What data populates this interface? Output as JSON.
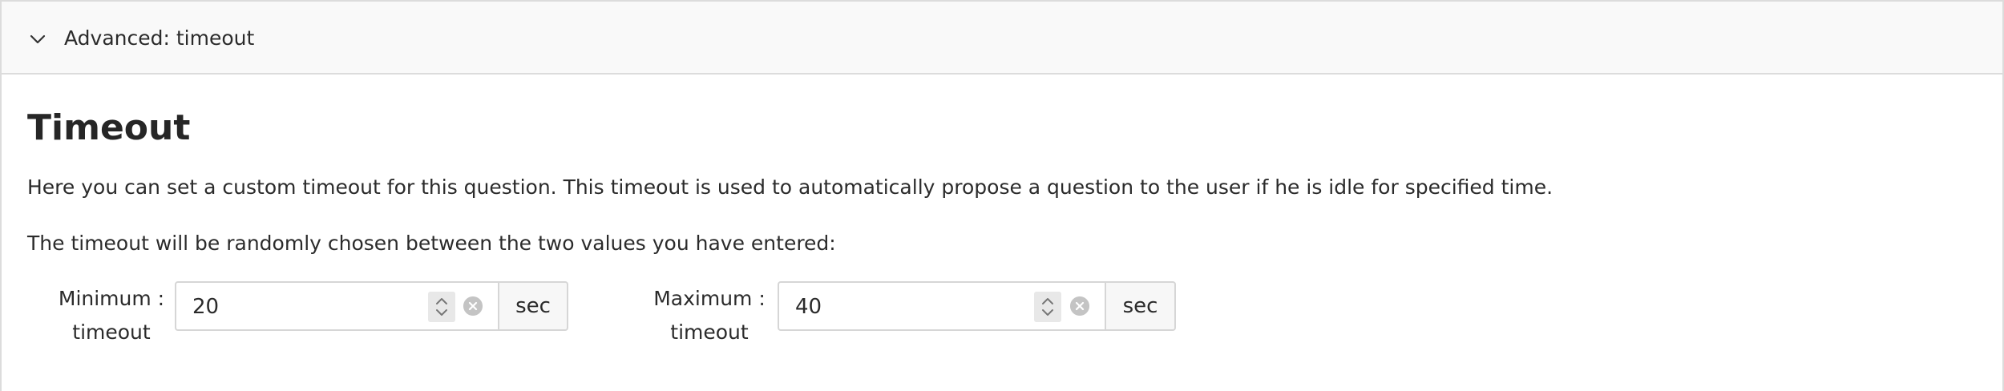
{
  "accordion": {
    "header_title": "Advanced: timeout",
    "expanded": true,
    "chevron_icon": "chevron-down-icon"
  },
  "content": {
    "title": "Timeout",
    "description_1": "Here you can set a custom timeout for this question. This timeout is used to automatically propose a question to the user if he is idle for specified time.",
    "description_2": "The timeout will be randomly chosen between the two values you have entered:"
  },
  "fields": {
    "minimum": {
      "label_line1": "Minimum :",
      "label_line2": "timeout",
      "value": "20",
      "unit": "sec"
    },
    "maximum": {
      "label_line1": "Maximum :",
      "label_line2": "timeout",
      "value": "40",
      "unit": "sec"
    }
  },
  "colors": {
    "header_bg": "#f9f9f9",
    "border": "#dcdcdc",
    "text": "#2b2b2b"
  }
}
